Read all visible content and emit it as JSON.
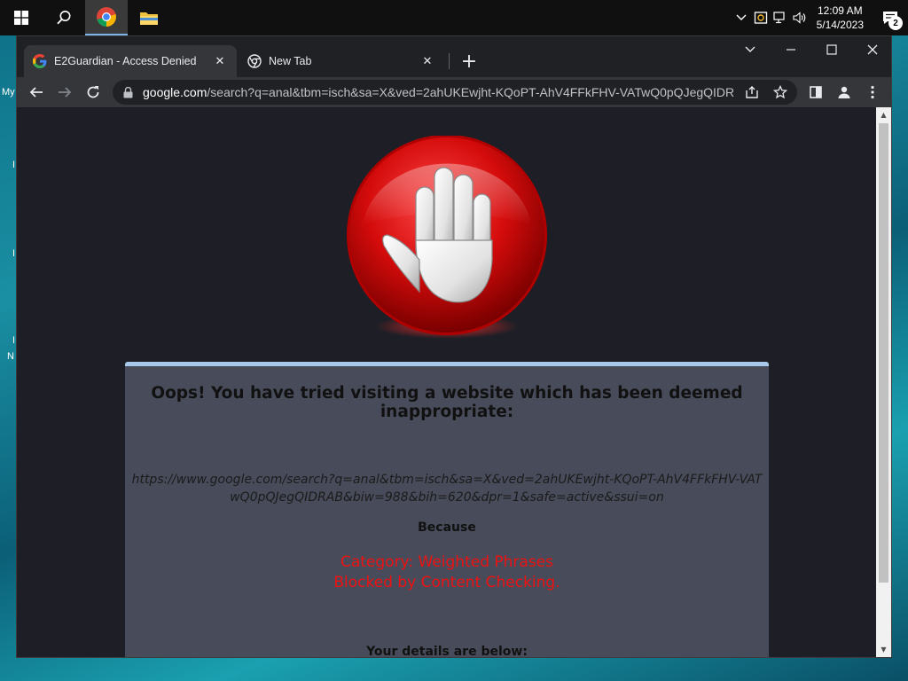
{
  "taskbar": {
    "start_icon": "windows-logo-icon",
    "search_icon": "search-icon",
    "chrome_icon": "chrome-icon",
    "explorer_icon": "file-explorer-icon",
    "clock_time": "12:09 AM",
    "clock_date": "5/14/2023",
    "notification_count": "2"
  },
  "desktop": {
    "stub_labels": [
      "My",
      "I",
      "I",
      "I",
      "N"
    ]
  },
  "browser": {
    "tabs": [
      {
        "title": "E2Guardian - Access Denied",
        "icon": "google-favicon",
        "active": true
      },
      {
        "title": "New Tab",
        "icon": "chrome-favicon",
        "active": false
      }
    ],
    "new_tab_label": "+",
    "address": {
      "host": "google.com",
      "path": "/search?q=anal&tbm=isch&sa=X&ved=2ahUKEwjht-KQoPT-AhV4FFkFHV-VATwQ0pQJegQIDR..."
    }
  },
  "page": {
    "headline": "Oops! You have tried visiting a website which has been deemed inappropriate:",
    "blocked_url_line1": "https://www.google.com/search?q=anal&tbm=isch&sa=X&ved=2ahUKEwjht-KQoPT-AhV4FFkFHV-VAT",
    "blocked_url_line2": "wQ0pQJegQIDRAB&biw=988&bih=620&dpr=1&safe=active&ssui=on",
    "because_label": "Because",
    "reason_line1": "Category: Weighted Phrases",
    "reason_line2": "Blocked by Content Checking.",
    "details_label": "Your details are below:"
  },
  "colors": {
    "reason_red": "#ee1111",
    "panel_bg": "#484c5a",
    "panel_accent": "#a9c9ec",
    "page_bg": "#1e1f26"
  }
}
